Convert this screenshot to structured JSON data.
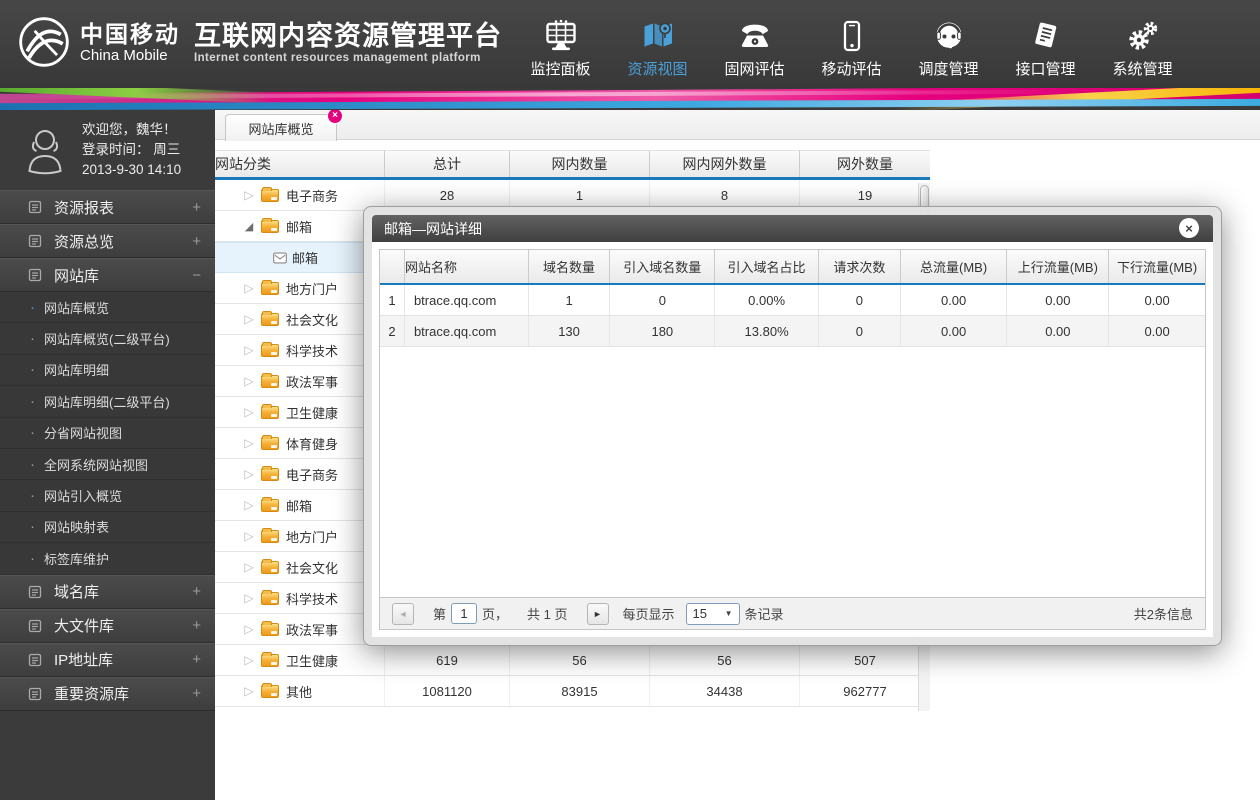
{
  "colors": {
    "accent_blue": "#1879bd",
    "active_nav": "#4aa0d9",
    "tab_close_pink": "#e5007d",
    "folder_orange": "#f6a821"
  },
  "header": {
    "logo_cn": "中国移动",
    "logo_en": "China Mobile",
    "title_cn": "互联网内容资源管理平台",
    "title_en": "Internet content resources management platform",
    "nav": [
      {
        "label": "监控面板"
      },
      {
        "label": "资源视图"
      },
      {
        "label": "固网评估"
      },
      {
        "label": "移动评估"
      },
      {
        "label": "调度管理"
      },
      {
        "label": "接口管理"
      },
      {
        "label": "系统管理"
      }
    ]
  },
  "sidebar": {
    "welcome": "欢迎您，魏华！",
    "login_line": "登录时间：  周三",
    "login_datetime": "2013-9-30   14:10",
    "sections": [
      {
        "label": "资源报表",
        "toggle": "+"
      },
      {
        "label": "资源总览",
        "toggle": "+"
      },
      {
        "label": "网站库",
        "toggle": "−",
        "items": [
          "网站库概览",
          "网站库概览(二级平台)",
          "网站库明细",
          "网站库明细(二级平台)",
          "分省网站视图",
          "全网系统网站视图",
          "网站引入概览",
          "网站映射表",
          "标签库维护"
        ]
      },
      {
        "label": "域名库",
        "toggle": "+"
      },
      {
        "label": "大文件库",
        "toggle": "+"
      },
      {
        "label": "IP地址库",
        "toggle": "+"
      },
      {
        "label": "重要资源库",
        "toggle": "+"
      }
    ]
  },
  "tab": {
    "label": "网站库概览"
  },
  "main_table": {
    "columns": [
      "网站分类",
      "总计",
      "网内数量",
      "网内网外数量",
      "网外数量"
    ],
    "rows": [
      {
        "label": "电子商务",
        "values": [
          "28",
          "1",
          "8",
          "19"
        ]
      },
      {
        "label": "邮箱",
        "values": [
          "",
          "",
          "",
          ""
        ]
      },
      {
        "label": "邮箱",
        "values": [
          "",
          "",
          "",
          ""
        ]
      },
      {
        "label": "地方门户",
        "values": [
          "",
          "",
          "",
          ""
        ]
      },
      {
        "label": "社会文化",
        "values": [
          "",
          "",
          "",
          ""
        ]
      },
      {
        "label": "科学技术",
        "values": [
          "",
          "",
          "",
          ""
        ]
      },
      {
        "label": "政法军事",
        "values": [
          "",
          "",
          "",
          ""
        ]
      },
      {
        "label": "卫生健康",
        "values": [
          "",
          "",
          "",
          ""
        ]
      },
      {
        "label": "体育健身",
        "values": [
          "",
          "",
          "",
          ""
        ]
      },
      {
        "label": "电子商务",
        "values": [
          "",
          "",
          "",
          ""
        ]
      },
      {
        "label": "邮箱",
        "values": [
          "",
          "",
          "",
          ""
        ]
      },
      {
        "label": "地方门户",
        "values": [
          "",
          "",
          "",
          ""
        ]
      },
      {
        "label": "社会文化",
        "values": [
          "",
          "",
          "",
          ""
        ]
      },
      {
        "label": "科学技术",
        "values": [
          "",
          "",
          "",
          ""
        ]
      },
      {
        "label": "政法军事",
        "values": [
          "",
          "",
          "",
          ""
        ]
      },
      {
        "label": "卫生健康",
        "values": [
          "619",
          "56",
          "56",
          "507"
        ]
      },
      {
        "label": "其他",
        "values": [
          "1081120",
          "83915",
          "34438",
          "962777"
        ]
      }
    ]
  },
  "modal": {
    "title": "邮箱—网站详细",
    "columns": [
      "",
      "网站名称",
      "域名数量",
      "引入域名数量",
      "引入域名占比",
      "请求次数",
      "总流量(MB)",
      "上行流量(MB)",
      "下行流量(MB)"
    ],
    "rows": [
      [
        "1",
        "btrace.qq.com",
        "1",
        "0",
        "0.00%",
        "0",
        "0.00",
        "0.00",
        "0.00"
      ],
      [
        "2",
        "btrace.qq.com",
        "130",
        "180",
        "13.80%",
        "0",
        "0.00",
        "0.00",
        "0.00"
      ]
    ],
    "pagination": {
      "prefix": "第",
      "page": "1",
      "suffix": "页，",
      "total_pages": "共 1 页",
      "per_page_label": "每页显示",
      "per_page_value": "15",
      "per_page_suffix": "条记录",
      "total_info": "共2条信息"
    }
  },
  "icons": {
    "close": "×",
    "prev": "◄",
    "next": "►",
    "caret": "▼",
    "collapsed": "▷",
    "expanded": "◢",
    "bullet": "·"
  }
}
